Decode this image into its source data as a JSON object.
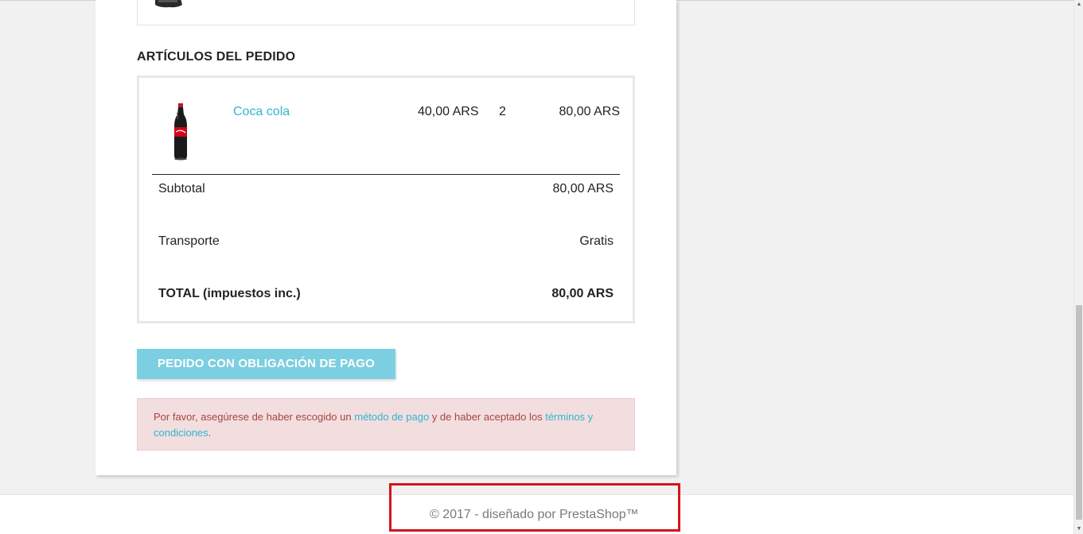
{
  "order": {
    "section_title": "ARTÍCULOS DEL PEDIDO",
    "items": [
      {
        "name": "Coca cola",
        "unit_price": "40,00 ARS",
        "quantity": "2",
        "total": "80,00 ARS",
        "image_icon": "coca-cola-bottle-icon"
      }
    ],
    "subtotal_label": "Subtotal",
    "subtotal_value": "80,00 ARS",
    "shipping_label": "Transporte",
    "shipping_value": "Gratis",
    "total_label": "TOTAL (impuestos inc.)",
    "total_value": "80,00 ARS"
  },
  "checkout": {
    "pay_button_label": "PEDIDO CON OBLIGACIÓN DE PAGO",
    "alert": {
      "text_1": "Por favor, asegúrese de haber escogido un ",
      "link_payment": "método de pago",
      "text_2": " y de haber aceptado los ",
      "link_terms": "términos y condiciones",
      "text_3": "."
    }
  },
  "footer": {
    "copyright": "© 2017 - diseñado por PrestaShop™"
  },
  "colors": {
    "link": "#2fb5d2",
    "button_disabled": "#7ccfe0",
    "alert_bg": "#f2dede",
    "alert_text": "#a94442",
    "highlight": "#d4141e"
  }
}
